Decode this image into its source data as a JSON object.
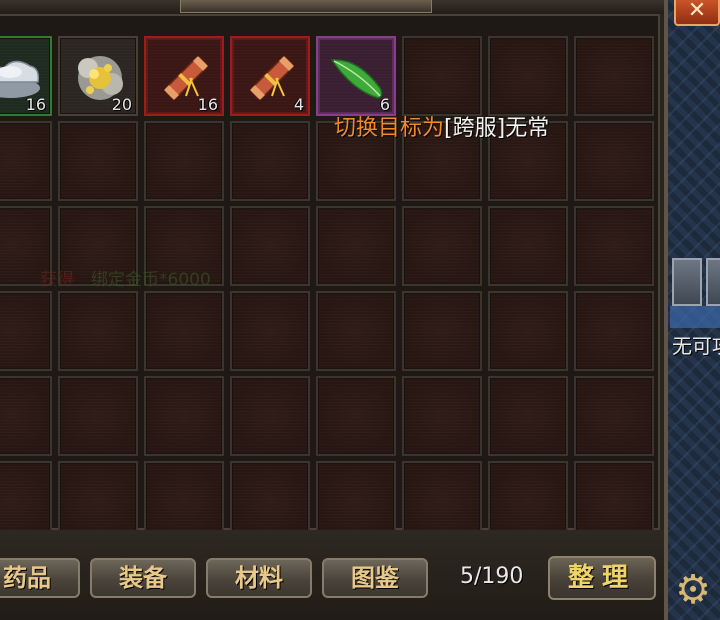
{
  "target_message": {
    "prefix": "切换目标为",
    "bracket": "[跨服]",
    "name": "无常"
  },
  "faint_message": {
    "part1": "获得",
    "part2": "绑定金币*6000"
  },
  "inventory": {
    "slots": [
      {
        "item": "silver-ingot",
        "count": "16",
        "quality": "green"
      },
      {
        "item": "gold-ore",
        "count": "20",
        "quality": "plain"
      },
      {
        "item": "firework-tube",
        "count": "16",
        "quality": "red"
      },
      {
        "item": "firework-tube",
        "count": "4",
        "quality": "red"
      },
      {
        "item": "green-feather",
        "count": "6",
        "quality": "purple"
      }
    ]
  },
  "tabs": {
    "medicine": "药品",
    "equipment": "装备",
    "materials": "材料",
    "catalog": "图鉴"
  },
  "capacity": "5/190",
  "sort_label": "整理",
  "map_side_text": "无可攻",
  "colors": {
    "orange_text": "#f28a2c",
    "tab_text": "#e9c98a",
    "sort_text": "#f0d46a"
  }
}
